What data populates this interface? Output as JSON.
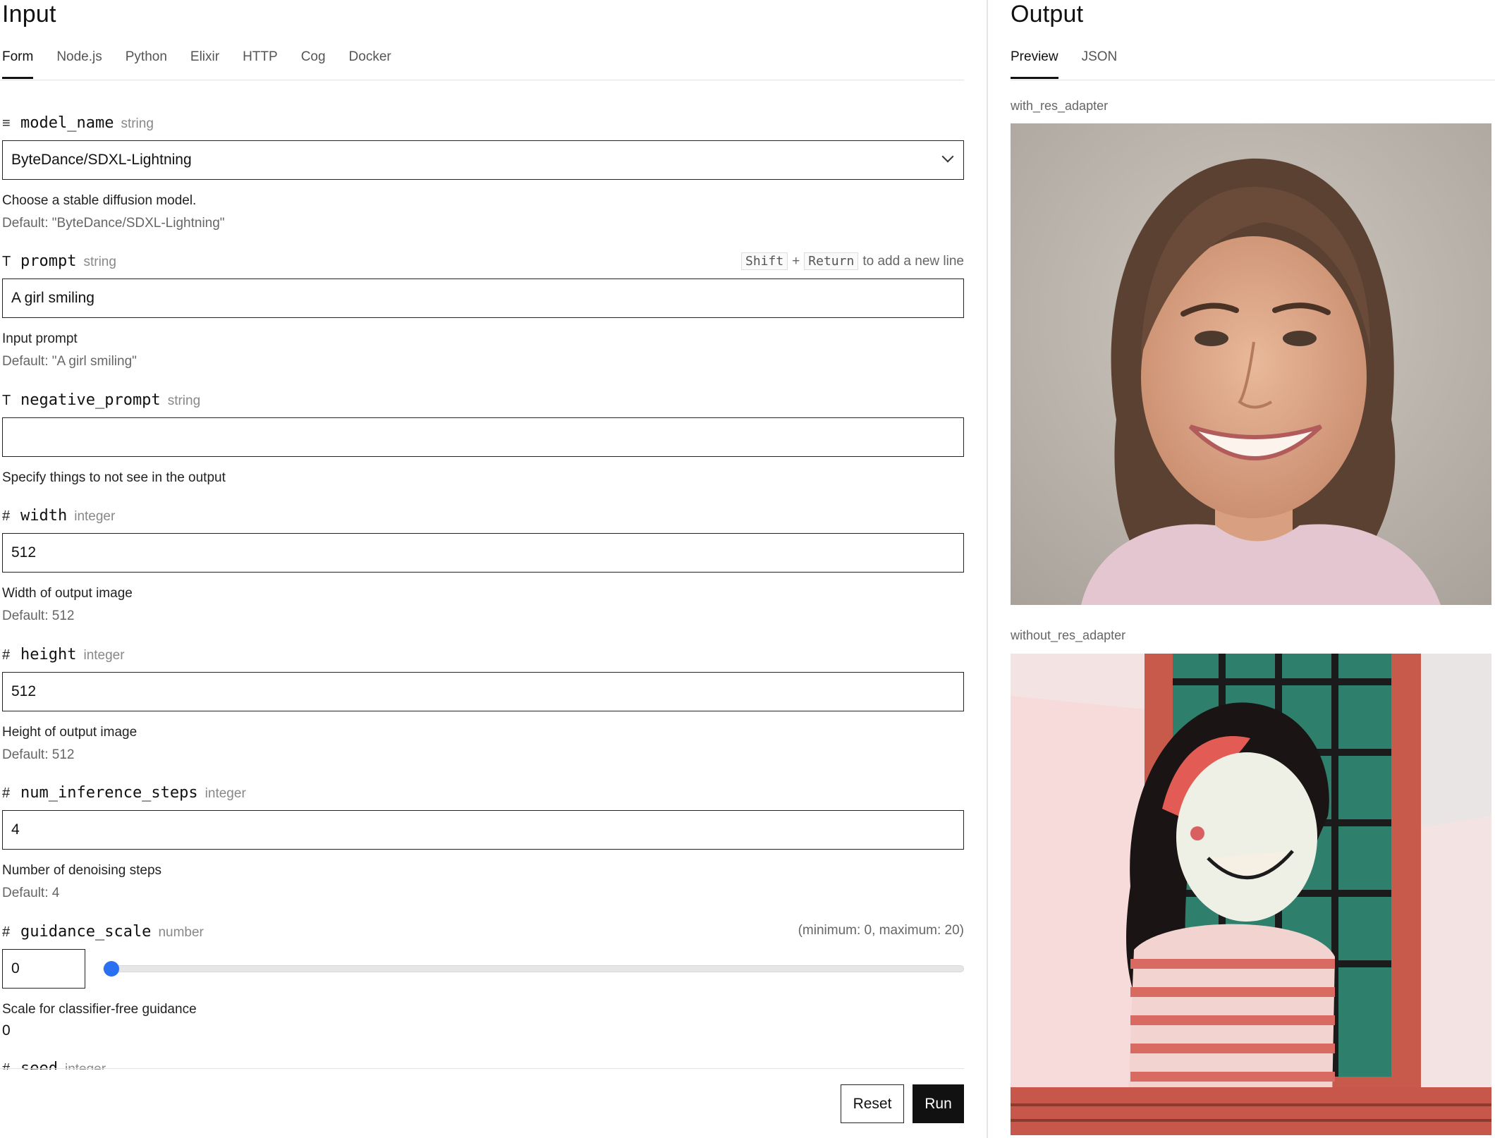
{
  "input": {
    "title": "Input",
    "tabs": [
      {
        "label": "Form",
        "active": true
      },
      {
        "label": "Node.js"
      },
      {
        "label": "Python"
      },
      {
        "label": "Elixir"
      },
      {
        "label": "HTTP"
      },
      {
        "label": "Cog"
      },
      {
        "label": "Docker"
      }
    ],
    "fields": {
      "model_name": {
        "icon": "≡",
        "name": "model_name",
        "type": "string",
        "value": "ByteDance/SDXL-Lightning",
        "description": "Choose a stable diffusion model.",
        "default": "Default: \"ByteDance/SDXL-Lightning\""
      },
      "prompt": {
        "icon": "T",
        "name": "prompt",
        "type": "string",
        "hint_key1": "Shift",
        "hint_plus": "+",
        "hint_key2": "Return",
        "hint_text": "to add a new line",
        "value": "A girl smiling",
        "description": "Input prompt",
        "default": "Default: \"A girl smiling\""
      },
      "negative_prompt": {
        "icon": "T",
        "name": "negative_prompt",
        "type": "string",
        "value": "",
        "description": "Specify things to not see in the output"
      },
      "width": {
        "icon": "#",
        "name": "width",
        "type": "integer",
        "value": "512",
        "description": "Width of output image",
        "default": "Default: 512"
      },
      "height": {
        "icon": "#",
        "name": "height",
        "type": "integer",
        "value": "512",
        "description": "Height of output image",
        "default": "Default: 512"
      },
      "num_inference_steps": {
        "icon": "#",
        "name": "num_inference_steps",
        "type": "integer",
        "value": "4",
        "description": "Number of denoising steps",
        "default": "Default: 4"
      },
      "guidance_scale": {
        "icon": "#",
        "name": "guidance_scale",
        "type": "number",
        "range_hint": "(minimum: 0, maximum: 20)",
        "value": "0",
        "slider_min": 0,
        "slider_max": 20,
        "slider_value": 0,
        "description": "Scale for classifier-free guidance",
        "current": "0"
      },
      "seed": {
        "icon": "#",
        "name": "seed",
        "type": "integer"
      }
    },
    "reset_label": "Reset",
    "run_label": "Run"
  },
  "output": {
    "title": "Output",
    "tabs": [
      {
        "label": "Preview",
        "active": true
      },
      {
        "label": "JSON"
      }
    ],
    "images": [
      {
        "label": "with_res_adapter"
      },
      {
        "label": "without_res_adapter"
      }
    ]
  },
  "colors": {
    "accent": "#2b6ff2",
    "run_button": "#111111"
  }
}
